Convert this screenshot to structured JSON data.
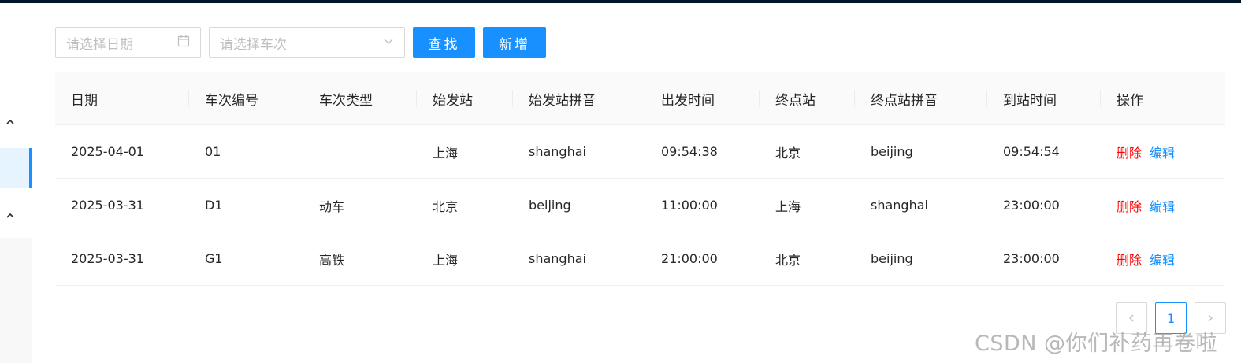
{
  "search": {
    "date_placeholder": "请选择日期",
    "train_placeholder": "请选择车次",
    "search_label": "查找",
    "add_label": "新增"
  },
  "table": {
    "headers": [
      "日期",
      "车次编号",
      "车次类型",
      "始发站",
      "始发站拼音",
      "出发时间",
      "终点站",
      "终点站拼音",
      "到站时间",
      "操作"
    ],
    "rows": [
      [
        "2025-04-01",
        "01",
        "",
        "上海",
        "shanghai",
        "09:54:38",
        "北京",
        "beijing",
        "09:54:54"
      ],
      [
        "2025-03-31",
        "D1",
        "动车",
        "北京",
        "beijing",
        "11:00:00",
        "上海",
        "shanghai",
        "23:00:00"
      ],
      [
        "2025-03-31",
        "G1",
        "高铁",
        "上海",
        "shanghai",
        "21:00:00",
        "北京",
        "beijing",
        "23:00:00"
      ]
    ],
    "delete_label": "删除",
    "edit_label": "编辑"
  },
  "pagination": {
    "current_page": "1"
  },
  "watermark": "CSDN @你们补药再卷啦",
  "icons": {
    "date": "calendar-icon",
    "select": "chevron-down-icon",
    "sidebar": "chevron-up-icon",
    "prev": "chevron-left-icon",
    "next": "chevron-right-icon"
  },
  "colors": {
    "primary": "#1890ff",
    "danger": "#ff0000",
    "header_bar": "#001529"
  }
}
